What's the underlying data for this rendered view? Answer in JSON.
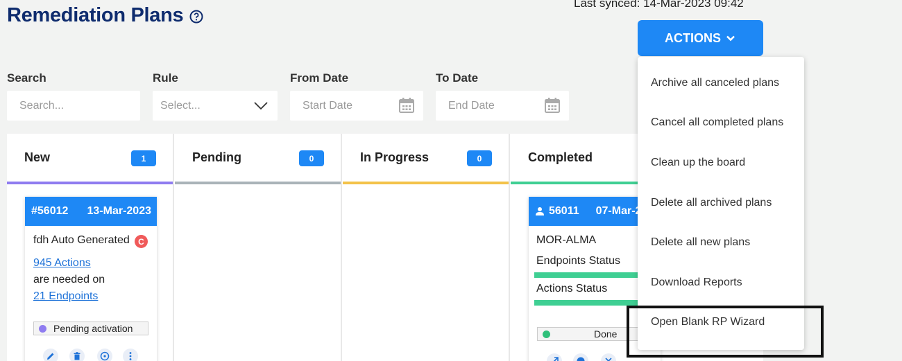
{
  "header": {
    "title": "Remediation Plans",
    "last_synced": "Last synced: 14-Mar-2023 09:42",
    "actions_label": "ACTIONS"
  },
  "filters": {
    "search": {
      "label": "Search",
      "placeholder": "Search..."
    },
    "rule": {
      "label": "Rule",
      "placeholder": "Select..."
    },
    "from_date": {
      "label": "From Date",
      "placeholder": "Start Date"
    },
    "to_date": {
      "label": "To Date",
      "placeholder": "End Date"
    }
  },
  "columns": [
    {
      "title": "New",
      "count": "1",
      "bar_color": "#8f7cf0"
    },
    {
      "title": "Pending",
      "count": "0",
      "bar_color": "#a9b3b8"
    },
    {
      "title": "In Progress",
      "count": "0",
      "bar_color": "#f3c24a"
    },
    {
      "title": "Completed",
      "count": "",
      "bar_color": "#3fcf93"
    }
  ],
  "cards": {
    "new_card": {
      "id": "#56012",
      "date": "13-Mar-2023",
      "name": "fdh Auto Generated",
      "badge": "C",
      "actions_link": "945 Actions",
      "middle_text": "are needed on",
      "endpoints_link": "21 Endpoints",
      "status": "Pending activation",
      "status_color": "#8f7cf0"
    },
    "completed_card": {
      "id": "56011",
      "date": "07-Mar-2",
      "name": "MOR-ALMA",
      "endpoints_status": "Endpoints Status",
      "actions_status": "Actions Status",
      "endpoints_progress": 1.0,
      "actions_progress": 1.0,
      "status": "Done",
      "status_color": "#2fc07a"
    }
  },
  "menu": {
    "items": [
      "Archive all canceled plans",
      "Cancel all completed plans",
      "Clean up the board",
      "Delete all archived plans",
      "Delete all new plans",
      "Download Reports",
      "Open Blank RP Wizard"
    ]
  },
  "colors": {
    "accent": "#1e88f5",
    "title": "#0f2c6e",
    "link": "#1e72d8"
  },
  "icons": [
    "help-icon",
    "chevron-down-icon",
    "calendar-icon",
    "edit-icon",
    "delete-icon",
    "network-icon",
    "more-icon",
    "user-icon",
    "expand-icon",
    "target-icon",
    "cancel-icon"
  ]
}
